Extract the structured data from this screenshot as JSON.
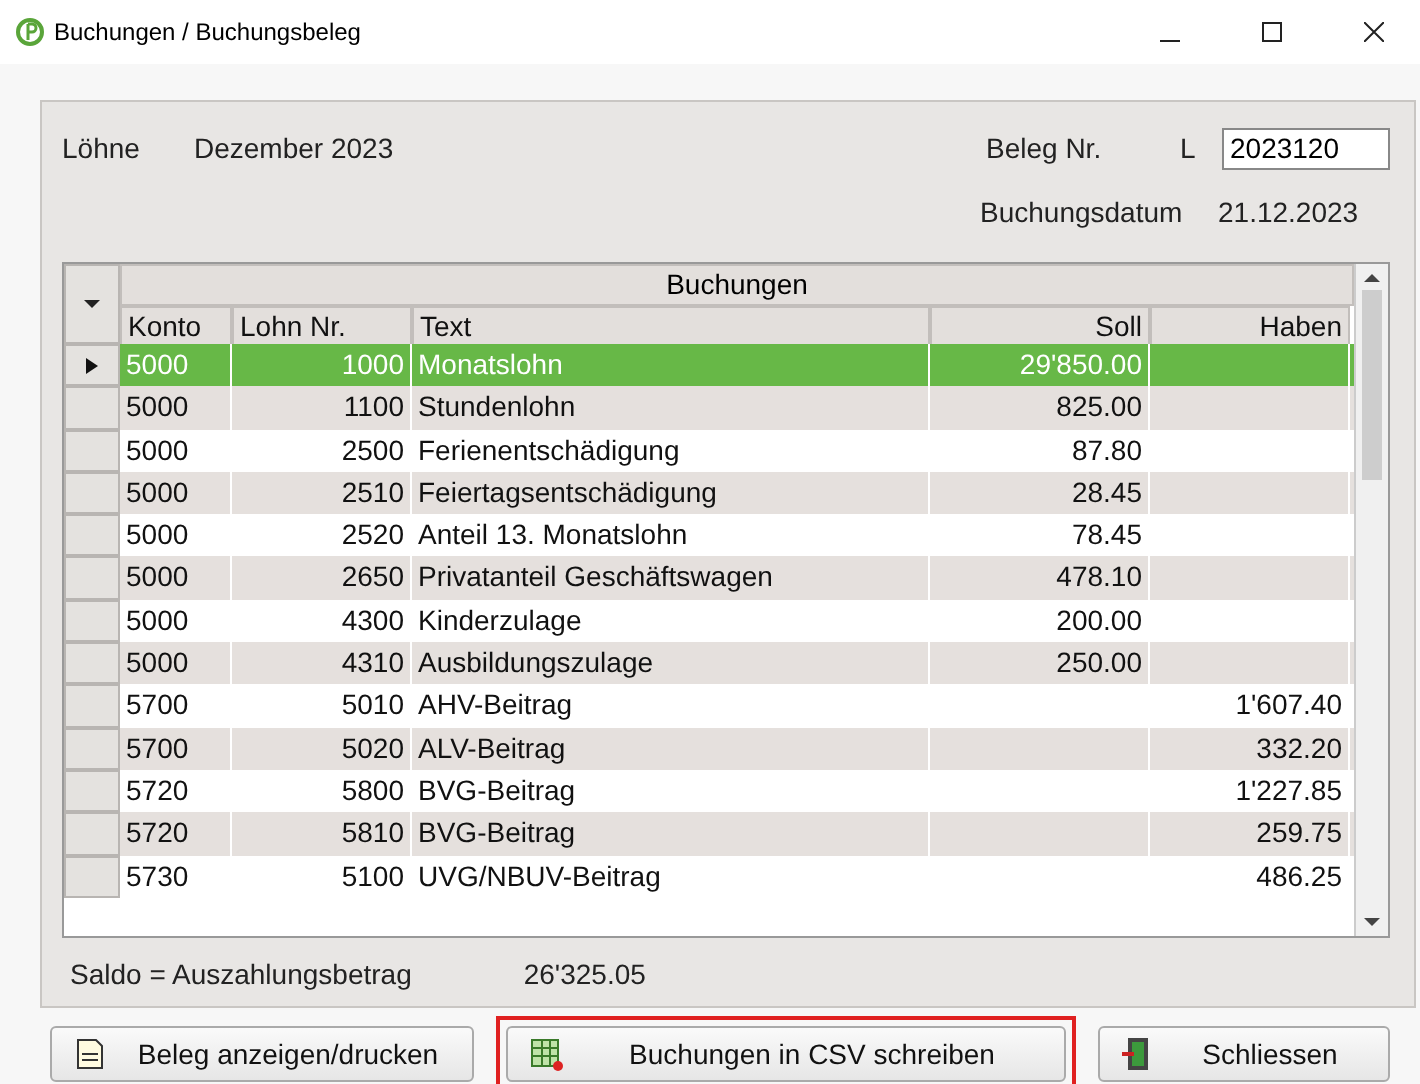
{
  "window": {
    "title": "Buchungen / Buchungsbeleg"
  },
  "header": {
    "category": "Löhne",
    "period": "Dezember 2023",
    "beleg_label": "Beleg Nr.",
    "beleg_prefix": "L",
    "beleg_value": "2023120",
    "date_label": "Buchungsdatum",
    "date_value": "21.12.2023"
  },
  "table": {
    "title": "Buchungen",
    "columns": [
      "Konto",
      "Lohn Nr.",
      "Text",
      "Soll",
      "Haben"
    ],
    "rows": [
      {
        "selected": true,
        "cells": [
          "5000",
          "1000",
          "Monatslohn",
          "29'850.00",
          ""
        ]
      },
      {
        "selected": false,
        "cells": [
          "5000",
          "1100",
          "Stundenlohn",
          "825.00",
          ""
        ]
      },
      {
        "selected": false,
        "cells": [
          "5000",
          "2500",
          "Ferienentschädigung",
          "87.80",
          ""
        ]
      },
      {
        "selected": false,
        "cells": [
          "5000",
          "2510",
          "Feiertagsentschädigung",
          "28.45",
          ""
        ]
      },
      {
        "selected": false,
        "cells": [
          "5000",
          "2520",
          "Anteil 13. Monatslohn",
          "78.45",
          ""
        ]
      },
      {
        "selected": false,
        "cells": [
          "5000",
          "2650",
          "Privatanteil Geschäftswagen",
          "478.10",
          ""
        ]
      },
      {
        "selected": false,
        "cells": [
          "5000",
          "4300",
          "Kinderzulage",
          "200.00",
          ""
        ]
      },
      {
        "selected": false,
        "cells": [
          "5000",
          "4310",
          "Ausbildungszulage",
          "250.00",
          ""
        ]
      },
      {
        "selected": false,
        "cells": [
          "5700",
          "5010",
          "AHV-Beitrag",
          "",
          "1'607.40"
        ]
      },
      {
        "selected": false,
        "cells": [
          "5700",
          "5020",
          "ALV-Beitrag",
          "",
          "332.20"
        ]
      },
      {
        "selected": false,
        "cells": [
          "5720",
          "5800",
          "BVG-Beitrag",
          "",
          "1'227.85"
        ]
      },
      {
        "selected": false,
        "cells": [
          "5720",
          "5810",
          "BVG-Beitrag",
          "",
          "259.75"
        ]
      },
      {
        "selected": false,
        "cells": [
          "5730",
          "5100",
          "UVG/NBUV-Beitrag",
          "",
          "486.25"
        ]
      }
    ]
  },
  "saldo": {
    "label": "Saldo = Auszahlungsbetrag",
    "value": "26'325.05"
  },
  "buttons": [
    {
      "kind": "print",
      "label": "Beleg anzeigen/drucken",
      "highlighted": false
    },
    {
      "kind": "csv",
      "label": "Buchungen in CSV schreiben",
      "highlighted": true
    },
    {
      "kind": "close",
      "label": "Schliessen",
      "highlighted": false
    }
  ]
}
